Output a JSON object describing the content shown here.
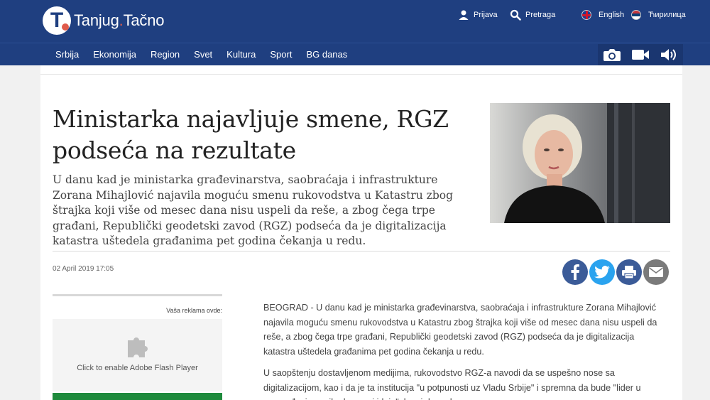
{
  "header": {
    "logo_brand": "Tanjug",
    "logo_dot": ".",
    "logo_tagline": "Tačno",
    "logo_letter": "T",
    "links": {
      "login": "Prijava",
      "search": "Pretraga",
      "english": "English",
      "cyrillic": "Ћирилица"
    }
  },
  "nav": {
    "items": [
      "Srbija",
      "Ekonomija",
      "Region",
      "Svet",
      "Kultura",
      "Sport",
      "BG danas"
    ],
    "media_icons": [
      "camera-icon",
      "video-icon",
      "audio-icon"
    ]
  },
  "article": {
    "headline": "Ministarka najavljuje smene, RGZ podseća na rezultate",
    "lead": "U danu kad je ministarka građevinarstva, saobraćaja i infrastrukture Zorana Mihajlović najavila moguću smenu rukovodstva u Katastru zbog štrajka koji više od mesec dana nisu uspeli da reše, a zbog čega trpe građani, Republički geodetski zavod (RGZ) podseća da je digitalizacija katastra uštedela građanima pet godina čekanja u redu.",
    "date": "02 April 2019 17:05",
    "paragraphs": [
      "BEOGRAD - U danu kad je ministarka građevinarstva, saobraćaja i infrastrukture Zorana Mihajlović najavila moguću smenu rukovodstva u Katastru zbog štrajka koji više od mesec dana nisu uspeli da reše, a zbog čega trpe građani, Republički geodetski zavod (RGZ) podseća da je digitalizacija katastra uštedela građanima pet godina čekanja u redu.",
      "U saopštenju dostavljenom medijima, rukovodstvo RGZ-a navodi da se uspešno nose sa digitalizacijom, kao i da je ta institucija \"u potpunosti uz Vladu Srbije\" i spremna da bude \"lider u sprovođenju novih planova i ideja\", kao i do sad."
    ]
  },
  "share": [
    "facebook-icon",
    "twitter-icon",
    "print-icon",
    "email-icon"
  ],
  "ad": {
    "label": "Vaša reklama ovde:",
    "plugin_text": "Click to enable Adobe Flash Player"
  },
  "colors": {
    "header_bg": "#1f3f80",
    "facebook": "#3b5b98",
    "twitter": "#2aa3ef",
    "email": "#7a7a7a",
    "brand_accent": "#e05a4a"
  }
}
